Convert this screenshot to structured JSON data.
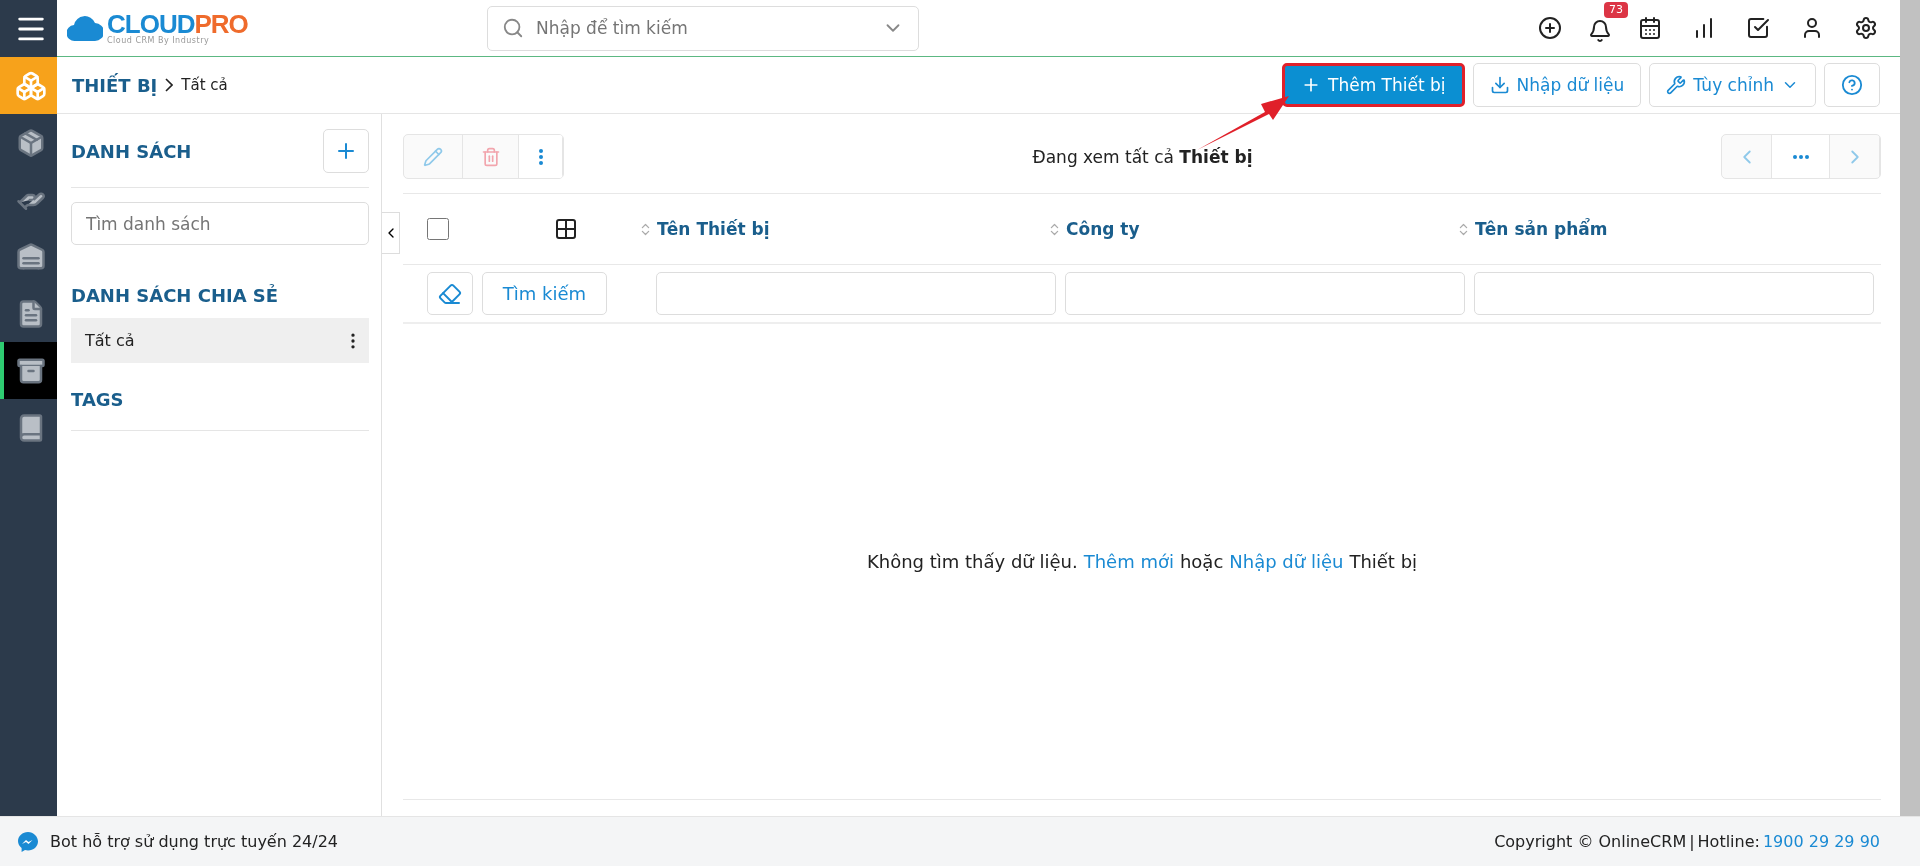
{
  "logo": {
    "name": "CLOUD",
    "name_accent": "PRO",
    "tagline": "Cloud CRM By Industry"
  },
  "search": {
    "placeholder": "Nhập để tìm kiếm"
  },
  "notifications": {
    "count": "73"
  },
  "rail": [
    {
      "selected": false
    },
    {
      "selected": false
    },
    {
      "selected": false
    },
    {
      "selected": false
    },
    {
      "selected": true
    },
    {
      "selected": false
    }
  ],
  "breadcrumb": {
    "module": "THIẾT BỊ",
    "current": "Tất cả"
  },
  "actions": {
    "add": "Thêm Thiết bị",
    "import": "Nhập dữ liệu",
    "customize": "Tùy chỉnh"
  },
  "sidebar": {
    "lists_title": "DANH SÁCH",
    "search_placeholder": "Tìm danh sách",
    "shared_title": "DANH SÁCH CHIA SẺ",
    "shared_items": [
      {
        "label": "Tất cả",
        "selected": true
      }
    ],
    "tags_title": "TAGS"
  },
  "viewing": "Đang xem tất cả **Thiết bị**",
  "table": {
    "columns": [
      "Tên Thiết bị",
      "Công ty",
      "Tên sản phẩm"
    ],
    "search_button": "Tìm kiếm",
    "select_all": false
  },
  "empty": {
    "text_1": "Không tìm thấy dữ liệu.",
    "link_add": "Thêm mới",
    "text_2": "hoặc",
    "link_import": "Nhập dữ liệu",
    "text_3": "Thiết bị"
  },
  "footer": {
    "bot": "Bot hỗ trợ sử dụng trực tuyến 24/24",
    "copyright": "Copyright © OnlineCRM",
    "separator": "|",
    "hotline_label": "Hotline:",
    "hotline": "1900 29 29 90"
  }
}
